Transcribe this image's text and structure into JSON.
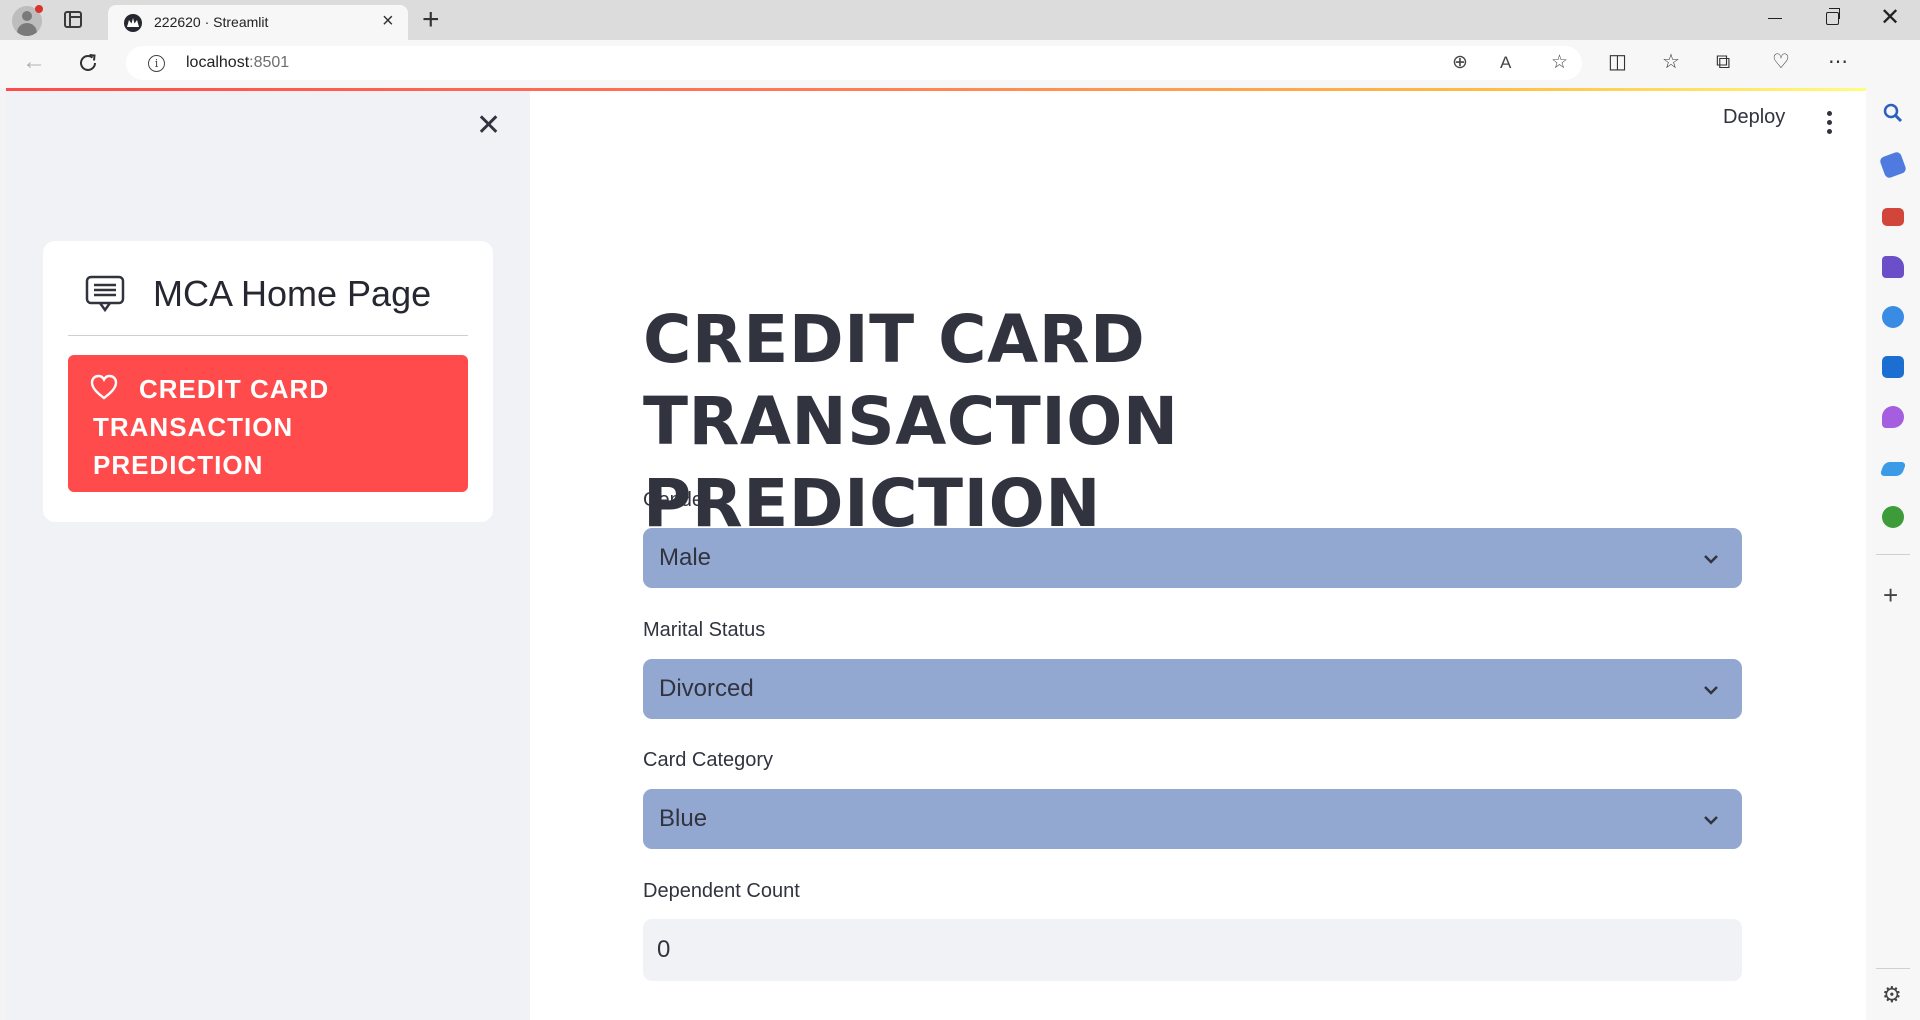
{
  "browser": {
    "tab_title": "222620 · Streamlit",
    "tab_close": "×",
    "new_tab": "+",
    "url_host": "localhost",
    "url_port": ":8501",
    "info_glyph": "i"
  },
  "sidebar": {
    "menu_title": "MCA Home Page",
    "close_glyph": "✕",
    "items": [
      {
        "label": "CREDIT CARD TRANSACTION PREDICTION",
        "icon": "heart-icon",
        "selected": true
      }
    ],
    "selected_color": "#ff4b4b"
  },
  "header": {
    "deploy_label": "Deploy"
  },
  "main": {
    "title": "CREDIT CARD TRANSACTION PREDICTION",
    "fields": [
      {
        "label": "Gender",
        "value": "Male"
      },
      {
        "label": "Marital Status",
        "value": "Divorced"
      },
      {
        "label": "Card Category",
        "value": "Blue"
      },
      {
        "label": "Dependent Count",
        "value": "0"
      }
    ],
    "select_color": "#93a8d1"
  },
  "colors": {
    "accent": "#ff4b4b",
    "sidebar_bg": "#f0f2f6",
    "text": "#31333f"
  }
}
